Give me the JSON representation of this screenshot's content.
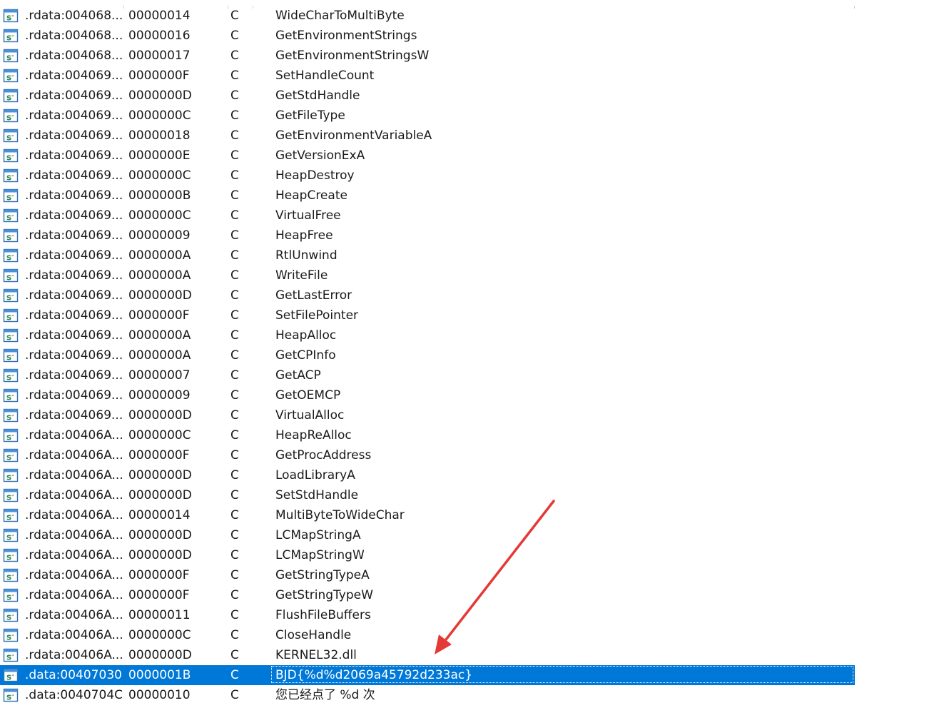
{
  "strings_window": {
    "rows": [
      {
        "address": ".rdata:004068...",
        "length": "00000014",
        "type": "C",
        "string": "WideCharToMultiByte",
        "selected": false
      },
      {
        "address": ".rdata:004068...",
        "length": "00000016",
        "type": "C",
        "string": "GetEnvironmentStrings",
        "selected": false
      },
      {
        "address": ".rdata:004068...",
        "length": "00000017",
        "type": "C",
        "string": "GetEnvironmentStringsW",
        "selected": false
      },
      {
        "address": ".rdata:004069...",
        "length": "0000000F",
        "type": "C",
        "string": "SetHandleCount",
        "selected": false
      },
      {
        "address": ".rdata:004069...",
        "length": "0000000D",
        "type": "C",
        "string": "GetStdHandle",
        "selected": false
      },
      {
        "address": ".rdata:004069...",
        "length": "0000000C",
        "type": "C",
        "string": "GetFileType",
        "selected": false
      },
      {
        "address": ".rdata:004069...",
        "length": "00000018",
        "type": "C",
        "string": "GetEnvironmentVariableA",
        "selected": false
      },
      {
        "address": ".rdata:004069...",
        "length": "0000000E",
        "type": "C",
        "string": "GetVersionExA",
        "selected": false
      },
      {
        "address": ".rdata:004069...",
        "length": "0000000C",
        "type": "C",
        "string": "HeapDestroy",
        "selected": false
      },
      {
        "address": ".rdata:004069...",
        "length": "0000000B",
        "type": "C",
        "string": "HeapCreate",
        "selected": false
      },
      {
        "address": ".rdata:004069...",
        "length": "0000000C",
        "type": "C",
        "string": "VirtualFree",
        "selected": false
      },
      {
        "address": ".rdata:004069...",
        "length": "00000009",
        "type": "C",
        "string": "HeapFree",
        "selected": false
      },
      {
        "address": ".rdata:004069...",
        "length": "0000000A",
        "type": "C",
        "string": "RtlUnwind",
        "selected": false
      },
      {
        "address": ".rdata:004069...",
        "length": "0000000A",
        "type": "C",
        "string": "WriteFile",
        "selected": false
      },
      {
        "address": ".rdata:004069...",
        "length": "0000000D",
        "type": "C",
        "string": "GetLastError",
        "selected": false
      },
      {
        "address": ".rdata:004069...",
        "length": "0000000F",
        "type": "C",
        "string": "SetFilePointer",
        "selected": false
      },
      {
        "address": ".rdata:004069...",
        "length": "0000000A",
        "type": "C",
        "string": "HeapAlloc",
        "selected": false
      },
      {
        "address": ".rdata:004069...",
        "length": "0000000A",
        "type": "C",
        "string": "GetCPInfo",
        "selected": false
      },
      {
        "address": ".rdata:004069...",
        "length": "00000007",
        "type": "C",
        "string": "GetACP",
        "selected": false
      },
      {
        "address": ".rdata:004069...",
        "length": "00000009",
        "type": "C",
        "string": "GetOEMCP",
        "selected": false
      },
      {
        "address": ".rdata:004069...",
        "length": "0000000D",
        "type": "C",
        "string": "VirtualAlloc",
        "selected": false
      },
      {
        "address": ".rdata:00406A...",
        "length": "0000000C",
        "type": "C",
        "string": "HeapReAlloc",
        "selected": false
      },
      {
        "address": ".rdata:00406A...",
        "length": "0000000F",
        "type": "C",
        "string": "GetProcAddress",
        "selected": false
      },
      {
        "address": ".rdata:00406A...",
        "length": "0000000D",
        "type": "C",
        "string": "LoadLibraryA",
        "selected": false
      },
      {
        "address": ".rdata:00406A...",
        "length": "0000000D",
        "type": "C",
        "string": "SetStdHandle",
        "selected": false
      },
      {
        "address": ".rdata:00406A...",
        "length": "00000014",
        "type": "C",
        "string": "MultiByteToWideChar",
        "selected": false
      },
      {
        "address": ".rdata:00406A...",
        "length": "0000000D",
        "type": "C",
        "string": "LCMapStringA",
        "selected": false
      },
      {
        "address": ".rdata:00406A...",
        "length": "0000000D",
        "type": "C",
        "string": "LCMapStringW",
        "selected": false
      },
      {
        "address": ".rdata:00406A...",
        "length": "0000000F",
        "type": "C",
        "string": "GetStringTypeA",
        "selected": false
      },
      {
        "address": ".rdata:00406A...",
        "length": "0000000F",
        "type": "C",
        "string": "GetStringTypeW",
        "selected": false
      },
      {
        "address": ".rdata:00406A...",
        "length": "00000011",
        "type": "C",
        "string": "FlushFileBuffers",
        "selected": false
      },
      {
        "address": ".rdata:00406A...",
        "length": "0000000C",
        "type": "C",
        "string": "CloseHandle",
        "selected": false
      },
      {
        "address": ".rdata:00406A...",
        "length": "0000000D",
        "type": "C",
        "string": "KERNEL32.dll",
        "selected": false
      },
      {
        "address": ".data:00407030",
        "length": "0000001B",
        "type": "C",
        "string": "BJD{%d%d2069a45792d233ac}",
        "selected": true
      },
      {
        "address": ".data:0040704C",
        "length": "00000010",
        "type": "C",
        "string": "您已经点了 %d 次",
        "selected": false
      }
    ],
    "row_icon": "string-item-icon",
    "colors": {
      "selection_bg": "#0078d7",
      "selection_text": "#ffffff",
      "annotation_arrow": "#e53935"
    },
    "annotation": {
      "icon": "red-arrow-annotation",
      "points_to_string": "BJD{%d%d2069a45792d233ac}"
    }
  }
}
